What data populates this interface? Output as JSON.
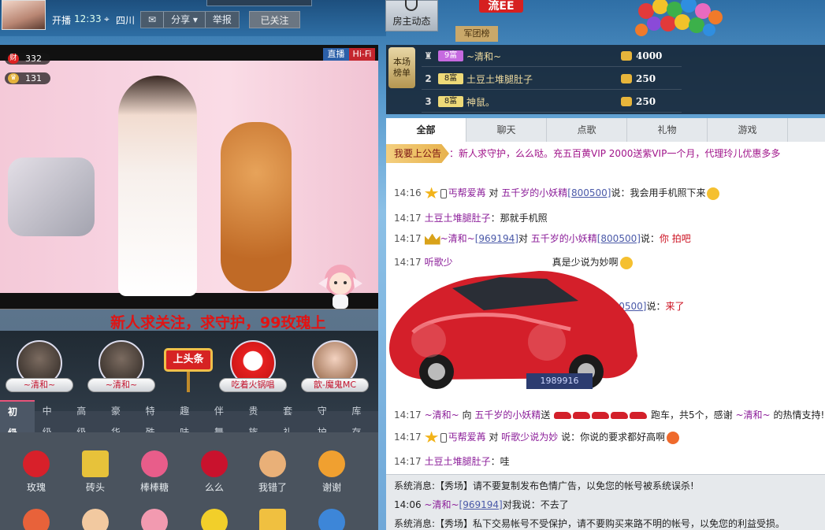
{
  "header": {
    "start_label": "开播",
    "start_time": "12:33",
    "location": "四川",
    "actions": [
      "分享",
      "举报"
    ],
    "followed_label": "已关注",
    "dynamics_label": "房主动态",
    "legion_label": "军团榜",
    "flag_label": "流EE"
  },
  "video": {
    "badge_live": "直播",
    "badge_hifi": "Hi-Fi",
    "wealth_icon": "财",
    "wealth_count": "332",
    "star_count": "131",
    "marquee": "新人求关注，求守护，99玫瑰上"
  },
  "guardians": [
    {
      "name": "~清和~"
    },
    {
      "name": "~清和~"
    },
    {
      "name": "吃着火锅唱"
    },
    {
      "name": "歆-魔鬼MC"
    }
  ],
  "headline_label": "上头条",
  "gift_tabs": [
    "初级",
    "中级",
    "高级",
    "豪华",
    "特殊",
    "趣味",
    "伴舞",
    "贵族",
    "套礼",
    "守护",
    "库存"
  ],
  "gifts": [
    {
      "name": "玫瑰",
      "color": "#d8202a"
    },
    {
      "name": "砖头",
      "color": "#e7c23a"
    },
    {
      "name": "棒棒糖",
      "color": "#e85d8a"
    },
    {
      "name": "么么",
      "color": "#c9122d"
    },
    {
      "name": "我错了",
      "color": "#e9b078"
    },
    {
      "name": "谢谢",
      "color": "#f0a030"
    }
  ],
  "gift_row2_colors": [
    "#e8623a",
    "#f2c9a0",
    "#f29ab0",
    "#f2cf2a",
    "#f0c040",
    "#3d86d8"
  ],
  "leaderboard": {
    "side_label_1": "本场",
    "side_label_2": "榜单",
    "rows": [
      {
        "rank": "",
        "level": "9富",
        "level_color": "purple",
        "name": "~清和~",
        "value": "4000"
      },
      {
        "rank": "2",
        "level": "8富",
        "level_color": "gold",
        "name": "土豆土堆腿肚子",
        "value": "250"
      },
      {
        "rank": "3",
        "level": "8富",
        "level_color": "gold",
        "name": "神鼠。",
        "value": "250"
      }
    ]
  },
  "chat_tabs": [
    "全部",
    "聊天",
    "点歌",
    "礼物",
    "游戏"
  ],
  "announcement": {
    "button": "我要上公告",
    "text": "：新人求守护，么么哒。充五百黄VIP 2000送紫VIP一个月，代理玲儿优惠多多"
  },
  "messages": [
    {
      "time": "14:16",
      "user": "丐帮爱苒",
      "mid": " 对 ",
      "target": "五千岁的小妖精",
      "target_id": "[800500]",
      "text": "说：我会用手机照下来"
    },
    {
      "time": "14:17",
      "user": "土豆土堆腿肚子",
      "text": "：那就手机照"
    },
    {
      "time": "14:17",
      "user": "~清和~",
      "user_id": "[969194]",
      "mid": "对 ",
      "target": "五千岁的小妖精",
      "target_id": "[800500]",
      "text": "说：",
      "red": "你 拍吧"
    },
    {
      "time": "14:17",
      "user": "听歌少",
      "text": "真是少说为妙啊"
    },
    {
      "target_id": "800500]",
      "text": "说：",
      "red": "来了"
    },
    {
      "time": "14:17",
      "user": "~清和~",
      "mid": " 向 ",
      "target": "五千岁的小妖精",
      "text": "送",
      "suffix": "跑车，共5个，感谢 ",
      "thank_user": "~清和~",
      "tail": " 的热情支持!"
    },
    {
      "time": "14:17",
      "user": "丐帮爱苒",
      "mid": " 对 ",
      "target": "听歌少说为妙",
      "text": " 说：你说的要求都好高啊"
    },
    {
      "time": "14:17",
      "user": "土豆土堆腿肚子",
      "text": "：哇"
    }
  ],
  "car_plate": "1989916",
  "system": [
    {
      "text": "系统消息:【秀场】请不要复制发布色情广告，以免您的帐号被系统误杀!"
    },
    {
      "time": "14:06",
      "user": "~清和~",
      "user_id": "[969194]",
      "text": "对我说：不去了"
    },
    {
      "text": "系统消息:【秀场】私下交易帐号不受保护，请不要购买来路不明的帐号，以免您的利益受损。"
    }
  ]
}
